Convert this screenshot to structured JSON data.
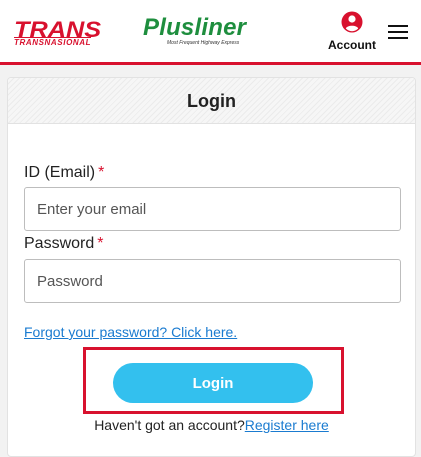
{
  "header": {
    "logo_trans_main": "TRANS",
    "logo_trans_sub": "TRANSNASIONAL",
    "logo_plus_main": "Plusliner",
    "logo_plus_tagline": "Most Frequent Highway Express",
    "account_label": "Account",
    "brand_red": "#d8112e",
    "brand_green": "#1e8e3e"
  },
  "login": {
    "title": "Login",
    "email_label": "ID (Email)",
    "email_required": "*",
    "email_placeholder": "Enter your email",
    "password_label": "Password",
    "password_required": "*",
    "password_placeholder": "Password",
    "forgot_link": "Forgot your password? Click here.",
    "login_button": "Login",
    "no_account_text": "Haven't got an account?",
    "register_link": "Register here",
    "button_color": "#33c0ee",
    "link_color": "#1a7bd0"
  }
}
